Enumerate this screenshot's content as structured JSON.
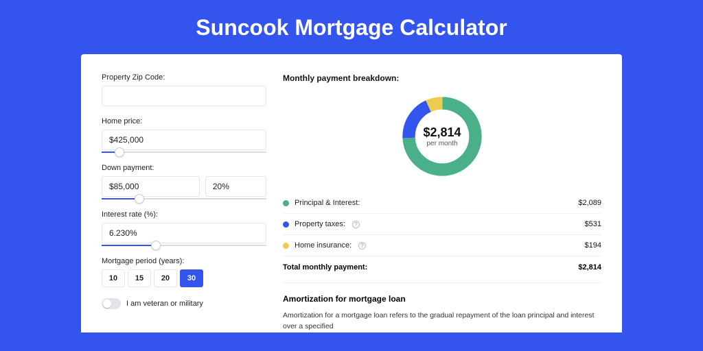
{
  "title": "Suncook Mortgage Calculator",
  "form": {
    "zip_label": "Property Zip Code:",
    "zip_value": "",
    "home_price_label": "Home price:",
    "home_price_value": "$425,000",
    "home_price_slider_pct": 8,
    "down_payment_label": "Down payment:",
    "down_payment_value": "$85,000",
    "down_payment_pct": "20%",
    "down_payment_slider_pct": 20,
    "interest_label": "Interest rate (%):",
    "interest_value": "6.230%",
    "interest_slider_pct": 30,
    "period_label": "Mortgage period (years):",
    "periods": [
      "10",
      "15",
      "20",
      "30"
    ],
    "period_active_index": 3,
    "veteran_label": "I am veteran or military",
    "veteran_on": false
  },
  "breakdown": {
    "title": "Monthly payment breakdown:",
    "center_amount": "$2,814",
    "center_sub": "per month",
    "items": [
      {
        "color": "green",
        "label": "Principal & Interest:",
        "value": "$2,089",
        "info": false
      },
      {
        "color": "blue",
        "label": "Property taxes:",
        "value": "$531",
        "info": true
      },
      {
        "color": "yellow",
        "label": "Home insurance:",
        "value": "$194",
        "info": true
      }
    ],
    "total_label": "Total monthly payment:",
    "total_value": "$2,814"
  },
  "amort": {
    "title": "Amortization for mortgage loan",
    "text": "Amortization for a mortgage loan refers to the gradual repayment of the loan principal and interest over a specified"
  },
  "chart_data": {
    "type": "pie",
    "title": "Monthly payment breakdown",
    "series": [
      {
        "name": "Principal & Interest",
        "value": 2089,
        "color": "#4ab08a"
      },
      {
        "name": "Property taxes",
        "value": 531,
        "color": "#3355ee"
      },
      {
        "name": "Home insurance",
        "value": 194,
        "color": "#eccb4e"
      }
    ],
    "total": 2814,
    "center_label": "$2,814 per month"
  }
}
